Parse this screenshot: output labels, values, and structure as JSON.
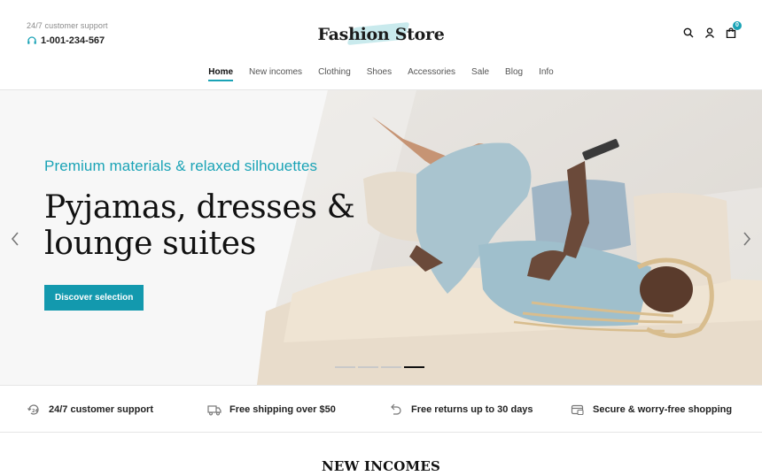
{
  "header": {
    "support_label": "24/7 customer support",
    "support_phone": "1-001-234-567",
    "logo": "Fashion Store",
    "cart_count": "0",
    "icons": [
      "search-icon",
      "user-icon",
      "cart-icon"
    ]
  },
  "nav": {
    "items": [
      "Home",
      "New incomes",
      "Clothing",
      "Shoes",
      "Accessories",
      "Sale",
      "Blog",
      "Info"
    ],
    "active": "Home"
  },
  "hero": {
    "subtitle": "Premium materials & relaxed silhouettes",
    "title": "Pyjamas, dresses & lounge suites",
    "button": "Discover selection",
    "slides_total": 4,
    "slide_active": 4
  },
  "features": [
    {
      "icon": "support-24-icon",
      "label": "24/7 customer support"
    },
    {
      "icon": "truck-icon",
      "label": "Free shipping over $50"
    },
    {
      "icon": "return-icon",
      "label": "Free returns up to 30 days"
    },
    {
      "icon": "secure-card-icon",
      "label": "Secure & worry-free shopping"
    }
  ],
  "section": {
    "title": "NEW INCOMES"
  },
  "colors": {
    "accent": "#1aa3b6",
    "button": "#1399ae",
    "text": "#111111"
  }
}
